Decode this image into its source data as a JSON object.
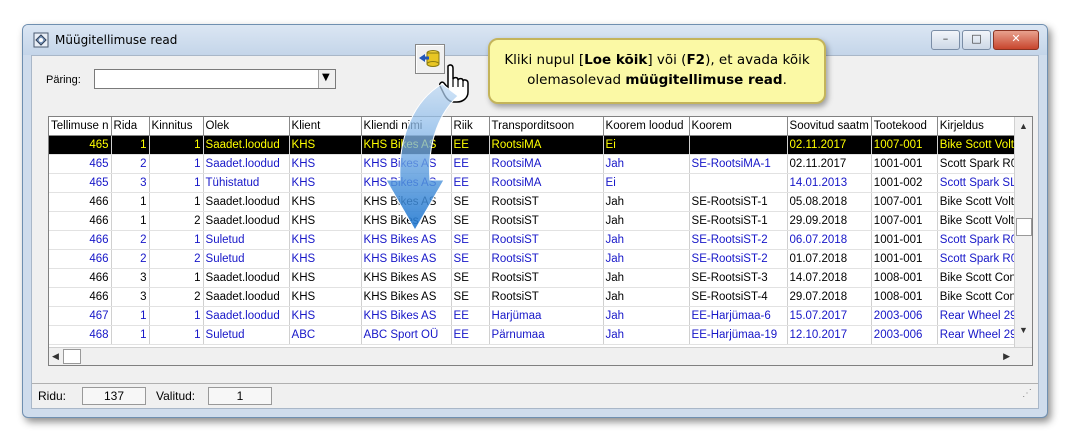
{
  "window": {
    "title": "Müügitellimuse read",
    "controls": {
      "minimize": "–",
      "maximize": "□",
      "close": "✕"
    }
  },
  "query": {
    "label": "Päring:",
    "value": ""
  },
  "grid": {
    "columns": [
      "Tellimuse n",
      "Rida",
      "Kinnitus",
      "Olek",
      "Klient",
      "Kliendi nimi",
      "Riik",
      "Transporditsoon",
      "Koorem loodud",
      "Koorem",
      "Soovitud saatm",
      "Tootekood",
      "Kirjeldus"
    ],
    "rows": [
      [
        "465",
        "1",
        "1",
        "Saadet.loodud",
        "KHS",
        "KHS Bikes AS",
        "EE",
        "RootsiMA",
        "Ei",
        "",
        "02.11.2017",
        "1007-001",
        "Bike Scott Volt"
      ],
      [
        "465",
        "2",
        "1",
        "Saadet.loodud",
        "KHS",
        "KHS Bikes AS",
        "EE",
        "RootsiMA",
        "Jah",
        "SE-RootsiMA-1",
        "02.11.2017",
        "1001-001",
        "Scott Spark R0"
      ],
      [
        "465",
        "3",
        "1",
        "Tühistatud",
        "KHS",
        "KHS Bikes AS",
        "EE",
        "RootsiMA",
        "Ei",
        "",
        "14.01.2013",
        "1001-002",
        "Scott Spark SL"
      ],
      [
        "466",
        "1",
        "1",
        "Saadet.loodud",
        "KHS",
        "KHS Bikes AS",
        "SE",
        "RootsiST",
        "Jah",
        "SE-RootsiST-1",
        "05.08.2018",
        "1007-001",
        "Bike Scott Volt"
      ],
      [
        "466",
        "1",
        "2",
        "Saadet.loodud",
        "KHS",
        "KHS Bikes AS",
        "SE",
        "RootsiST",
        "Jah",
        "SE-RootsiST-1",
        "29.09.2018",
        "1007-001",
        "Bike Scott Volt"
      ],
      [
        "466",
        "2",
        "1",
        "Suletud",
        "KHS",
        "KHS Bikes AS",
        "SE",
        "RootsiST",
        "Jah",
        "SE-RootsiST-2",
        "06.07.2018",
        "1001-001",
        "Scott Spark R0"
      ],
      [
        "466",
        "2",
        "2",
        "Suletud",
        "KHS",
        "KHS Bikes AS",
        "SE",
        "RootsiST",
        "Jah",
        "SE-RootsiST-2",
        "01.07.2018",
        "1001-001",
        "Scott Spark R0"
      ],
      [
        "466",
        "3",
        "1",
        "Saadet.loodud",
        "KHS",
        "KHS Bikes AS",
        "SE",
        "RootsiST",
        "Jah",
        "SE-RootsiST-3",
        "14.07.2018",
        "1008-001",
        "Bike Scott Con"
      ],
      [
        "466",
        "3",
        "2",
        "Saadet.loodud",
        "KHS",
        "KHS Bikes AS",
        "SE",
        "RootsiST",
        "Jah",
        "SE-RootsiST-4",
        "29.07.2018",
        "1008-001",
        "Bike Scott Con"
      ],
      [
        "467",
        "1",
        "1",
        "Saadet.loodud",
        "KHS",
        "KHS Bikes AS",
        "EE",
        "Harjümaa",
        "Jah",
        "EE-Harjümaa-6",
        "15.07.2017",
        "2003-006",
        "Rear Wheel 29"
      ],
      [
        "468",
        "1",
        "1",
        "Suletud",
        "ABC",
        "ABC Sport OÜ",
        "EE",
        "Pärnumaa",
        "Jah",
        "EE-Harjümaa-19",
        "12.10.2017",
        "2003-006",
        "Rear Wheel 29"
      ]
    ],
    "row_styles": [
      "sel",
      "blue",
      "blue",
      "black",
      "black",
      "blue",
      "blue",
      "black",
      "black",
      "blue",
      "blue"
    ],
    "cell_colors": {
      "1": {
        "10": "black",
        "11": "black",
        "12": "black"
      },
      "2": {
        "10": "blue",
        "11": "black",
        "12": "blue"
      },
      "5": {
        "10": "blue",
        "11": "black",
        "12": "blue"
      },
      "6": {
        "10": "black",
        "11": "black",
        "12": "blue"
      }
    }
  },
  "status": {
    "rows_label": "Ridu:",
    "rows_value": "137",
    "selected_label": "Valitud:",
    "selected_value": "1"
  },
  "tooltip": {
    "part1": "Kliki nupul [",
    "bold1": "Loe kõik",
    "part2": "] või (",
    "bold2": "F2",
    "part3": "), et avada kõik olemasolevad ",
    "bold3": "müügitellimuse read",
    "part4": "."
  },
  "colors": {
    "row_blue": "#1616c8",
    "selected_bg": "#000000",
    "selected_fg": "#ffff00",
    "tooltip_bg": "#fbf9a5",
    "arrow": "#3f8fd8"
  },
  "icons": {
    "load_all": "load-all-icon",
    "hand": "hand-pointer-icon",
    "app": "app-window-icon"
  }
}
